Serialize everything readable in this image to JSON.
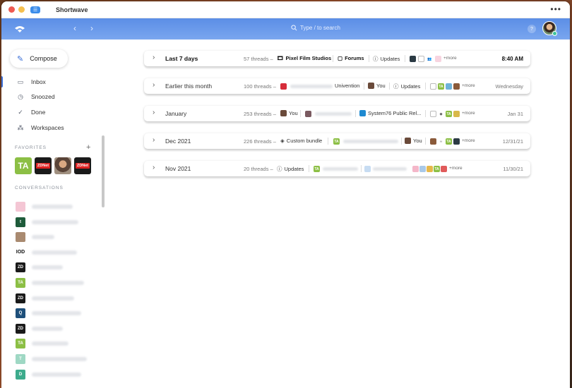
{
  "window": {
    "title": "Shortwave",
    "menu_glyph": "•••"
  },
  "topbar": {
    "back_glyph": "‹",
    "forward_glyph": "›",
    "search_placeholder": "Type / to search",
    "help_glyph": "?"
  },
  "sidebar": {
    "compose_label": "Compose",
    "nav": [
      {
        "label": "Inbox",
        "icon": "inbox-icon"
      },
      {
        "label": "Snoozed",
        "icon": "clock-icon"
      },
      {
        "label": "Done",
        "icon": "check-icon"
      },
      {
        "label": "Workspaces",
        "icon": "workspaces-icon"
      }
    ],
    "favorites_label": "FAVORITES",
    "favorites_add": "+",
    "favorites": [
      {
        "kind": "ta",
        "text": "TA"
      },
      {
        "kind": "zd",
        "text": "ZDNet"
      },
      {
        "kind": "photo",
        "text": ""
      },
      {
        "kind": "zd",
        "text": "ZDNet"
      }
    ],
    "conversations_label": "CONVERSATIONS",
    "conversations": [
      {
        "icon_text": "",
        "color": "#f4c6d4"
      },
      {
        "icon_text": "t",
        "color": "#1e5b3a"
      },
      {
        "icon_text": "",
        "color": "#a98a70"
      },
      {
        "icon_text": "IOD",
        "color": "#ffffff"
      },
      {
        "icon_text": "ZD",
        "color": "#1a1a1a"
      },
      {
        "icon_text": "TA",
        "color": "#8cbf45"
      },
      {
        "icon_text": "ZD",
        "color": "#1a1a1a"
      },
      {
        "icon_text": "Q",
        "color": "#1e4f7a"
      },
      {
        "icon_text": "ZD",
        "color": "#1a1a1a"
      },
      {
        "icon_text": "TA",
        "color": "#8cbf45"
      },
      {
        "icon_text": "T",
        "color": "#9fd8c4"
      },
      {
        "icon_text": "D",
        "color": "#3dab8c"
      }
    ]
  },
  "groups": [
    {
      "title": "Last 7 days",
      "count": "57 threads –",
      "chips": [
        "Pixel Film Studios",
        "Forums",
        "Updates"
      ],
      "more": "+more",
      "date": "8:40 AM"
    },
    {
      "title": "Earlier this month",
      "count": "100 threads –",
      "chips": [
        "Univention",
        "You",
        "Updates"
      ],
      "more": "+more",
      "date": "Wednesday"
    },
    {
      "title": "January",
      "count": "253 threads –",
      "chips": [
        "You",
        "System76 Public Rel..."
      ],
      "more": "+more",
      "date": "Jan 31"
    },
    {
      "title": "Dec 2021",
      "count": "226 threads –",
      "chips": [
        "Custom bundle",
        "You",
        "TA"
      ],
      "more": "+more",
      "date": "12/31/21"
    },
    {
      "title": "Nov 2021",
      "count": "20 threads –",
      "chips": [
        "Updates"
      ],
      "more": "+more",
      "date": "11/30/21"
    }
  ],
  "colors": {
    "accent": "#3a6fd8",
    "topbar": "#6b9cec",
    "online": "#3dc39c"
  }
}
